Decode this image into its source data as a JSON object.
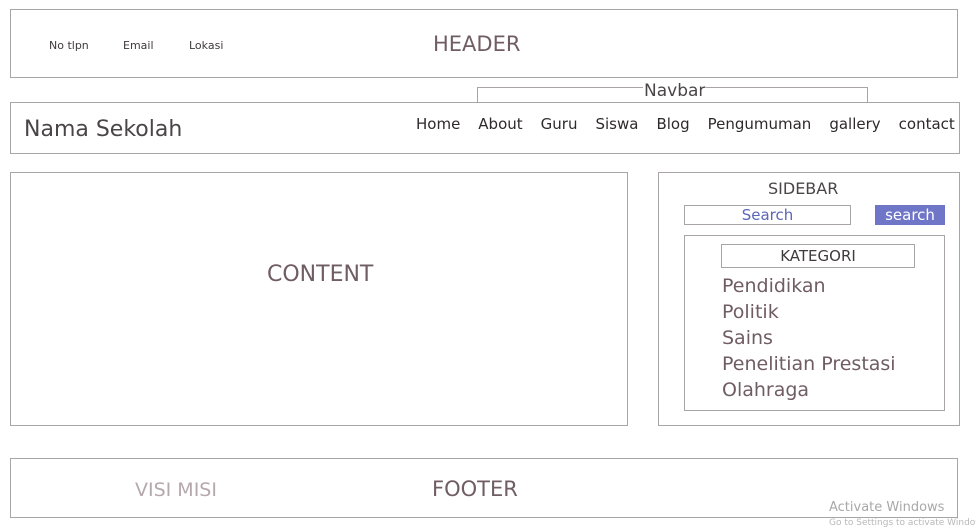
{
  "header": {
    "contacts": [
      "No tlpn",
      "Email",
      "Lokasi"
    ],
    "title": "HEADER"
  },
  "navbar": {
    "label": "Navbar",
    "school_name": "Nama Sekolah",
    "items": [
      "Home",
      "About",
      "Guru",
      "Siswa",
      "Blog",
      "Pengumuman",
      "gallery",
      "contact"
    ]
  },
  "content": {
    "title": "CONTENT"
  },
  "sidebar": {
    "title": "SIDEBAR",
    "search_placeholder": "Search",
    "search_button": "search",
    "kategori_title": "KATEGORI",
    "kategori": [
      "Pendidikan",
      "Politik",
      "Sains",
      "Penelitian Prestasi",
      "Olahraga"
    ]
  },
  "footer": {
    "left_text": "VISI MISI",
    "title": "FOOTER"
  },
  "watermark": {
    "title": "Activate Windows",
    "subtitle": "Go to Settings to activate Windows."
  },
  "colors": {
    "accent_button": "#6f76c7",
    "search_text": "#5a66b8",
    "border": "#a9a4a6"
  }
}
